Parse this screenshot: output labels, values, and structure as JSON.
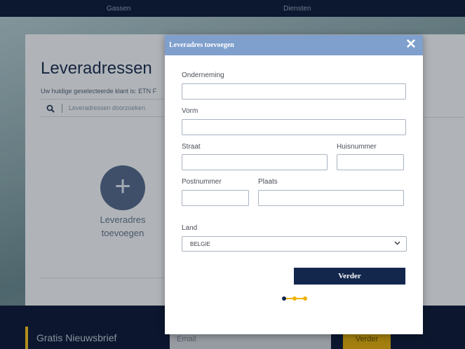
{
  "background": {
    "nav": [
      "Gassen",
      "Diensten"
    ],
    "title": "Leveradressen",
    "subtitle": "Uw huidige geselecteerde klant is: ETN F",
    "search_placeholder": "Leveradressen doorzoeken",
    "add_card_label_line1": "Leveradres",
    "add_card_label_line2": "toevoegen",
    "footer": {
      "newsletter_label": "Gratis Nieuwsbrief",
      "email_placeholder": "Email",
      "submit_label": "Verder"
    }
  },
  "modal": {
    "title": "Leveradres toevoegen",
    "close_icon": "close-icon",
    "fields": {
      "onderneming": {
        "label": "Onderneming",
        "value": ""
      },
      "vorm": {
        "label": "Vorm",
        "value": ""
      },
      "straat": {
        "label": "Straat",
        "value": ""
      },
      "huisnummer": {
        "label": "Huisnummer",
        "value": ""
      },
      "postnummer": {
        "label": "Postnummer",
        "value": ""
      },
      "plaats": {
        "label": "Plaats",
        "value": ""
      },
      "land": {
        "label": "Land",
        "selected": "BELGIE"
      }
    },
    "submit_label": "Verder",
    "progress": {
      "total_steps": 3,
      "current_step": 1
    }
  },
  "colors": {
    "modal_header": "#7f9fcc",
    "primary_button": "#13274d",
    "accent_yellow": "#f0b400",
    "footer_button": "#c69c12"
  }
}
